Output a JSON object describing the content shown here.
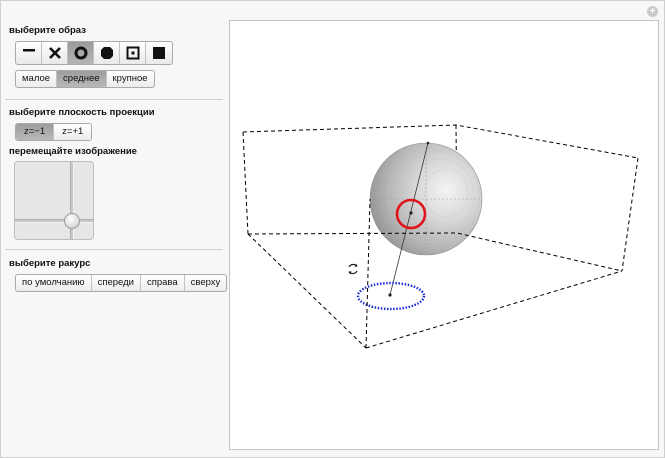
{
  "sections": {
    "shape_label": "выберите образ",
    "projection_label": "выберите плоскость проекции",
    "move_label": "перемещайте изображение",
    "view_label": "выберите ракурс"
  },
  "shape_icons": [
    {
      "name": "line-shape-icon",
      "selected": false
    },
    {
      "name": "cross-shape-icon",
      "selected": false
    },
    {
      "name": "ring-shape-icon",
      "selected": true
    },
    {
      "name": "disk-shape-icon",
      "selected": false
    },
    {
      "name": "square-dot-shape-icon",
      "selected": false
    },
    {
      "name": "square-shape-icon",
      "selected": false
    }
  ],
  "sizes": {
    "items": [
      "малое",
      "среднее",
      "крупное"
    ],
    "selected": "среднее"
  },
  "projection": {
    "items": [
      "z=−1",
      "z=+1"
    ],
    "selected": "z=−1"
  },
  "views": {
    "items": [
      "по умолчанию",
      "спереди",
      "справа",
      "сверху"
    ]
  },
  "colors": {
    "ring": "#e0141b",
    "projection_ring": "#1a2bd6",
    "box_edges": "#000000"
  }
}
